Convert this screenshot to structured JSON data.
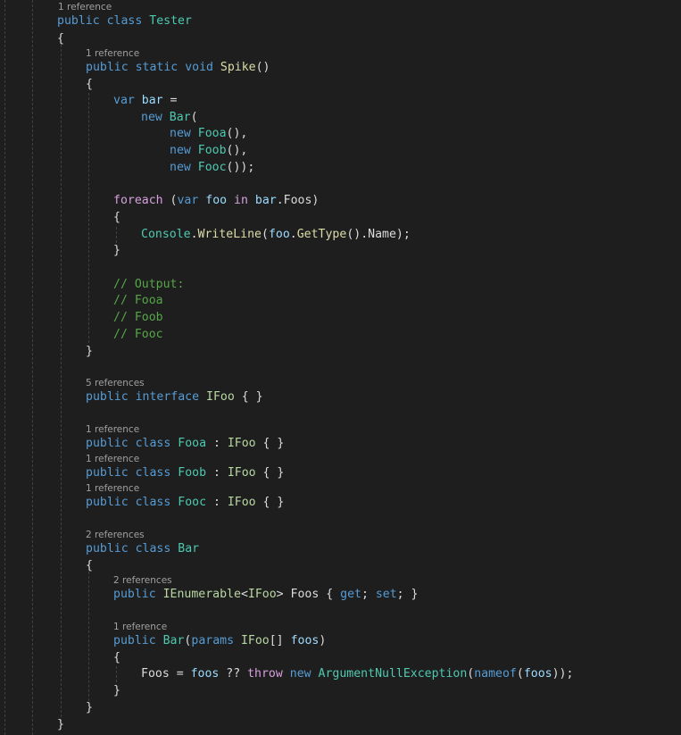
{
  "editor": {
    "theme": "dark",
    "colors": {
      "background": "#1e1e1e",
      "keyword": "#569cd6",
      "control": "#d8a0df",
      "type": "#4ec9b0",
      "interface": "#b8d7a3",
      "method": "#dcdcaa",
      "variable": "#9cdcfe",
      "comment": "#57a64a",
      "text": "#dcdcdc",
      "codelens": "#a0a0a0"
    }
  },
  "codelens": {
    "tester": "1 reference",
    "spike": "1 reference",
    "ifoo": "5 references",
    "fooa": "1 reference",
    "foob": "1 reference",
    "fooc": "1 reference",
    "bar": "2 references",
    "foos_prop": "2 references",
    "bar_ctor": "1 reference"
  },
  "lines": {
    "l1": [
      [
        "kw",
        "public"
      ],
      [
        "plain",
        " "
      ],
      [
        "kw",
        "class"
      ],
      [
        "plain",
        " "
      ],
      [
        "type",
        "Tester"
      ]
    ],
    "l2": [
      [
        "plain",
        "{"
      ]
    ],
    "l3": [
      [
        "kw",
        "public"
      ],
      [
        "plain",
        " "
      ],
      [
        "kw",
        "static"
      ],
      [
        "plain",
        " "
      ],
      [
        "kw",
        "void"
      ],
      [
        "plain",
        " "
      ],
      [
        "method",
        "Spike"
      ],
      [
        "plain",
        "()"
      ]
    ],
    "l4": [
      [
        "plain",
        "{"
      ]
    ],
    "l5": [
      [
        "kw",
        "var"
      ],
      [
        "plain",
        " "
      ],
      [
        "var",
        "bar"
      ],
      [
        "plain",
        " ="
      ]
    ],
    "l6": [
      [
        "kw",
        "new"
      ],
      [
        "plain",
        " "
      ],
      [
        "type",
        "Bar"
      ],
      [
        "plain",
        "("
      ]
    ],
    "l7": [
      [
        "kw",
        "new"
      ],
      [
        "plain",
        " "
      ],
      [
        "type",
        "Fooa"
      ],
      [
        "plain",
        "(),"
      ]
    ],
    "l8": [
      [
        "kw",
        "new"
      ],
      [
        "plain",
        " "
      ],
      [
        "type",
        "Foob"
      ],
      [
        "plain",
        "(),"
      ]
    ],
    "l9": [
      [
        "kw",
        "new"
      ],
      [
        "plain",
        " "
      ],
      [
        "type",
        "Fooc"
      ],
      [
        "plain",
        "());"
      ]
    ],
    "l10": [
      [
        "ctrl",
        "foreach"
      ],
      [
        "plain",
        " ("
      ],
      [
        "kw",
        "var"
      ],
      [
        "plain",
        " "
      ],
      [
        "var",
        "foo"
      ],
      [
        "plain",
        " "
      ],
      [
        "ctrl",
        "in"
      ],
      [
        "plain",
        " "
      ],
      [
        "var",
        "bar"
      ],
      [
        "plain",
        ".Foos)"
      ]
    ],
    "l11": [
      [
        "plain",
        "{"
      ]
    ],
    "l12": [
      [
        "type",
        "Console"
      ],
      [
        "plain",
        "."
      ],
      [
        "method",
        "WriteLine"
      ],
      [
        "plain",
        "("
      ],
      [
        "var",
        "foo"
      ],
      [
        "plain",
        "."
      ],
      [
        "method",
        "GetType"
      ],
      [
        "plain",
        "().Name);"
      ]
    ],
    "l13": [
      [
        "plain",
        "}"
      ]
    ],
    "l14": [
      [
        "cmt",
        "// Output:"
      ]
    ],
    "l15": [
      [
        "cmt",
        "// Fooa"
      ]
    ],
    "l16": [
      [
        "cmt",
        "// Foob"
      ]
    ],
    "l17": [
      [
        "cmt",
        "// Fooc"
      ]
    ],
    "l18": [
      [
        "plain",
        "}"
      ]
    ],
    "l19": [
      [
        "kw",
        "public"
      ],
      [
        "plain",
        " "
      ],
      [
        "kw",
        "interface"
      ],
      [
        "plain",
        " "
      ],
      [
        "iface",
        "IFoo"
      ],
      [
        "plain",
        " { }"
      ]
    ],
    "l20": [
      [
        "kw",
        "public"
      ],
      [
        "plain",
        " "
      ],
      [
        "kw",
        "class"
      ],
      [
        "plain",
        " "
      ],
      [
        "type",
        "Fooa"
      ],
      [
        "plain",
        " : "
      ],
      [
        "iface",
        "IFoo"
      ],
      [
        "plain",
        " { }"
      ]
    ],
    "l21": [
      [
        "kw",
        "public"
      ],
      [
        "plain",
        " "
      ],
      [
        "kw",
        "class"
      ],
      [
        "plain",
        " "
      ],
      [
        "type",
        "Foob"
      ],
      [
        "plain",
        " : "
      ],
      [
        "iface",
        "IFoo"
      ],
      [
        "plain",
        " { }"
      ]
    ],
    "l22": [
      [
        "kw",
        "public"
      ],
      [
        "plain",
        " "
      ],
      [
        "kw",
        "class"
      ],
      [
        "plain",
        " "
      ],
      [
        "type",
        "Fooc"
      ],
      [
        "plain",
        " : "
      ],
      [
        "iface",
        "IFoo"
      ],
      [
        "plain",
        " { }"
      ]
    ],
    "l23": [
      [
        "kw",
        "public"
      ],
      [
        "plain",
        " "
      ],
      [
        "kw",
        "class"
      ],
      [
        "plain",
        " "
      ],
      [
        "type",
        "Bar"
      ]
    ],
    "l24": [
      [
        "plain",
        "{"
      ]
    ],
    "l25": [
      [
        "kw",
        "public"
      ],
      [
        "plain",
        " "
      ],
      [
        "iface",
        "IEnumerable"
      ],
      [
        "plain",
        "<"
      ],
      [
        "iface",
        "IFoo"
      ],
      [
        "plain",
        "> Foos { "
      ],
      [
        "kw",
        "get"
      ],
      [
        "plain",
        "; "
      ],
      [
        "kw",
        "set"
      ],
      [
        "plain",
        "; }"
      ]
    ],
    "l26": [
      [
        "kw",
        "public"
      ],
      [
        "plain",
        " "
      ],
      [
        "type",
        "Bar"
      ],
      [
        "plain",
        "("
      ],
      [
        "kw",
        "params"
      ],
      [
        "plain",
        " "
      ],
      [
        "iface",
        "IFoo"
      ],
      [
        "plain",
        "[] "
      ],
      [
        "var",
        "foos"
      ],
      [
        "plain",
        ")"
      ]
    ],
    "l27": [
      [
        "plain",
        "{"
      ]
    ],
    "l28": [
      [
        "plain",
        "Foos = "
      ],
      [
        "var",
        "foos"
      ],
      [
        "plain",
        " ?? "
      ],
      [
        "ctrl",
        "throw"
      ],
      [
        "plain",
        " "
      ],
      [
        "kw",
        "new"
      ],
      [
        "plain",
        " "
      ],
      [
        "type",
        "ArgumentNullException"
      ],
      [
        "plain",
        "("
      ],
      [
        "kw",
        "nameof"
      ],
      [
        "plain",
        "("
      ],
      [
        "var",
        "foos"
      ],
      [
        "plain",
        "));"
      ]
    ],
    "l29": [
      [
        "plain",
        "}"
      ]
    ],
    "l30": [
      [
        "plain",
        "}"
      ]
    ],
    "l31": [
      [
        "plain",
        "}"
      ]
    ]
  }
}
